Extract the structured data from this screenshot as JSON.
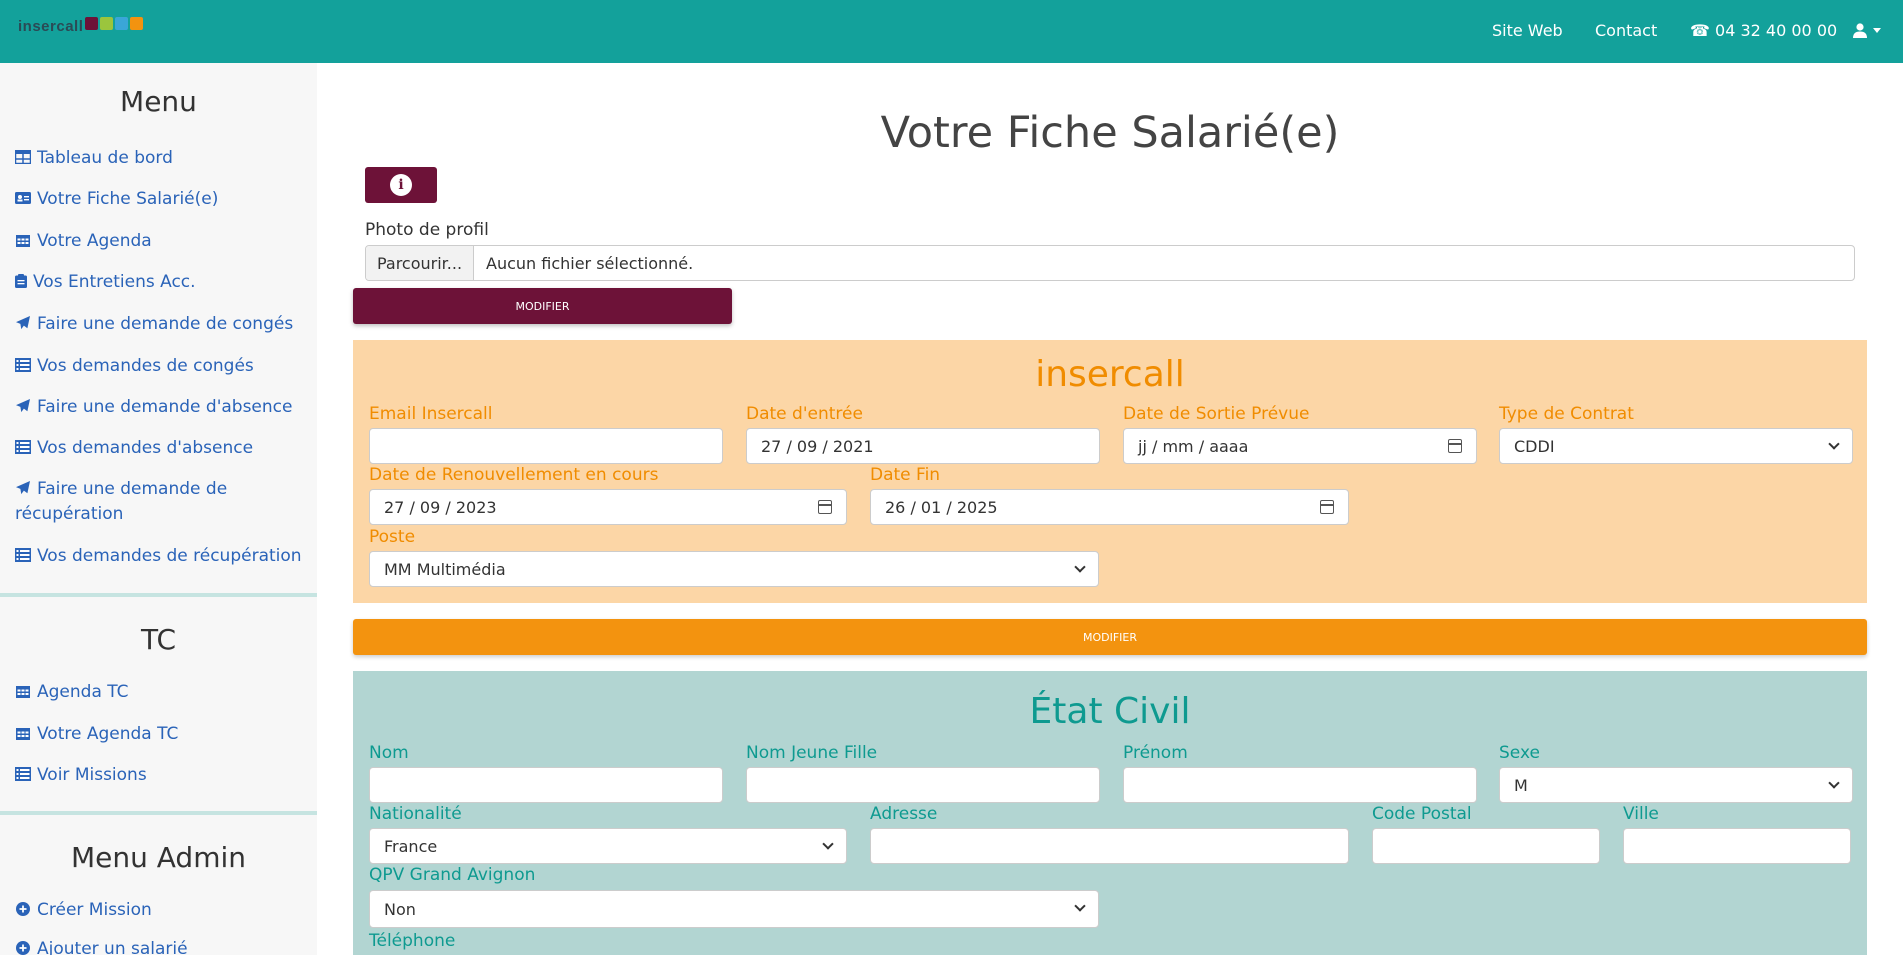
{
  "colors": {
    "topbar": "#13a19b",
    "maroon": "#6d1238",
    "orange": "#f3930f",
    "orange_panel": "#fcd6a6",
    "orange_label": "#f08c00",
    "teal_panel": "#b2d5d2",
    "teal_label": "#0e9a90",
    "link": "#2a63b8"
  },
  "topbar": {
    "logo_text": "insercall",
    "site_web": "Site Web",
    "contact": "Contact",
    "phone": "04 32 40 00 00"
  },
  "sidebar": {
    "menu_title": "Menu",
    "menu_items": [
      {
        "label": "Tableau de bord",
        "icon": "table-icon"
      },
      {
        "label": "Votre Fiche Salarié(e)",
        "icon": "id-card-icon"
      },
      {
        "label": "Votre Agenda",
        "icon": "calendar-icon"
      },
      {
        "label": "Vos Entretiens Acc.",
        "icon": "clipboard-icon"
      },
      {
        "label": "Faire une demande de congés",
        "icon": "paper-plane-icon"
      },
      {
        "label": "Vos demandes de congés",
        "icon": "list-icon"
      },
      {
        "label": "Faire une demande d'absence",
        "icon": "paper-plane-icon"
      },
      {
        "label": "Vos demandes d'absence",
        "icon": "list-icon"
      },
      {
        "label": "Faire une demande de récupération",
        "icon": "paper-plane-icon"
      },
      {
        "label": "Vos demandes de récupération",
        "icon": "list-icon"
      }
    ],
    "tc_title": "TC",
    "tc_items": [
      {
        "label": "Agenda TC",
        "icon": "calendar-icon"
      },
      {
        "label": "Votre Agenda TC",
        "icon": "calendar-icon"
      },
      {
        "label": "Voir Missions",
        "icon": "list-icon"
      }
    ],
    "admin_title": "Menu Admin",
    "admin_items": [
      {
        "label": "Créer Mission",
        "icon": "plus-circle-icon"
      },
      {
        "label": "Ajouter un salarié",
        "icon": "plus-circle-icon"
      }
    ]
  },
  "main": {
    "title": "Votre Fiche Salarié(e)",
    "photo_label": "Photo de profil",
    "browse_label": "Parcourir...",
    "file_status": "Aucun fichier sélectionné.",
    "modify_label": "MODIFIER"
  },
  "insercall_section": {
    "title": "insercall",
    "email_label": "Email Insercall",
    "email_value": "",
    "date_entree_label": "Date d'entrée",
    "date_entree_value": "27 / 09 / 2021",
    "date_sortie_label": "Date de Sortie Prévue",
    "date_sortie_value": "jj / mm / aaaa",
    "contrat_label": "Type de Contrat",
    "contrat_value": "CDDI",
    "renouvellement_label": "Date de Renouvellement en cours",
    "renouvellement_value": "27 / 09 / 2023",
    "date_fin_label": "Date Fin",
    "date_fin_value": "26 / 01 / 2025",
    "poste_label": "Poste",
    "poste_value": "MM Multimédia",
    "modify_label": "MODIFIER"
  },
  "etat_civil": {
    "title": "État Civil",
    "nom_label": "Nom",
    "nom_jeune_fille_label": "Nom Jeune Fille",
    "prenom_label": "Prénom",
    "sexe_label": "Sexe",
    "sexe_value": "M",
    "nationalite_label": "Nationalité",
    "nationalite_value": "France",
    "adresse_label": "Adresse",
    "code_postal_label": "Code Postal",
    "ville_label": "Ville",
    "qpv_label": "QPV Grand Avignon",
    "qpv_value": "Non",
    "telephone_label": "Téléphone"
  }
}
